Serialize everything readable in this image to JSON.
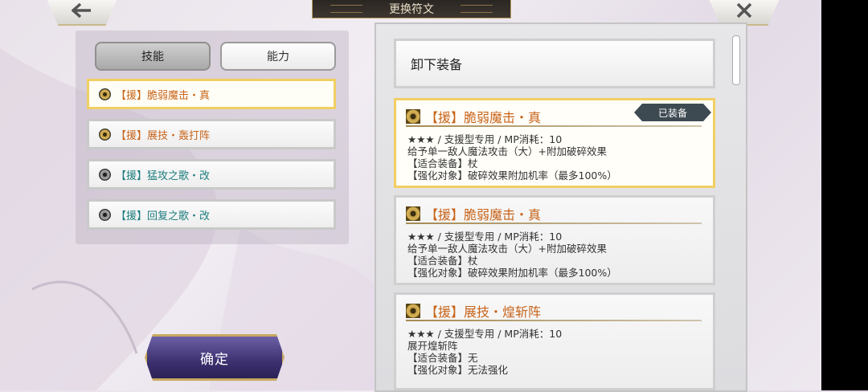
{
  "header": {
    "title": "更换符文"
  },
  "tabs": [
    {
      "label": "技能",
      "active": true
    },
    {
      "label": "能力",
      "active": false
    }
  ],
  "rune_list": [
    {
      "label": "【援】脆弱魔击・真",
      "color": "#c8641a",
      "selected": true,
      "icon": "gold-rune-gem-icon"
    },
    {
      "label": "【援】展技・轰打阵",
      "color": "#c8641a",
      "selected": false,
      "icon": "gold-rune-gem-icon"
    },
    {
      "label": "【援】猛攻之歌・改",
      "color": "#1c7c7e",
      "selected": false,
      "icon": "grey-rune-gem-icon"
    },
    {
      "label": "【援】回复之歌・改",
      "color": "#1c7c7e",
      "selected": false,
      "icon": "grey-rune-gem-icon"
    }
  ],
  "confirm_label": "确定",
  "unequip_label": "卸下装备",
  "cards": [
    {
      "name": "【援】脆弱魔击・真",
      "badge": "已装备",
      "stats": "★★★ / 支援型专用 / MP消耗：10",
      "desc": "给予单一敌人魔法攻击（大）+附加破碎效果",
      "equip": "【适合装备】杖",
      "enhance": "【强化对象】破碎效果附加机率（最多100%）"
    },
    {
      "name": "【援】脆弱魔击・真",
      "badge": "",
      "stats": "★★★ / 支援型专用 / MP消耗：10",
      "desc": "给予单一敌人魔法攻击（大）+附加破碎效果",
      "equip": "【适合装备】杖",
      "enhance": "【强化对象】破碎效果附加机率（最多100%）"
    },
    {
      "name": "【援】展技・煌斩阵",
      "badge": "",
      "stats": "★★★ / 支援型专用 / MP消耗：10",
      "desc": "展开煌斩阵",
      "equip": "【适合装备】无",
      "enhance": "【强化对象】无法强化"
    }
  ],
  "colors": {
    "accent_orange": "#c8641a",
    "accent_teal": "#1c7c7e",
    "selected_border": "#f1cf62"
  }
}
